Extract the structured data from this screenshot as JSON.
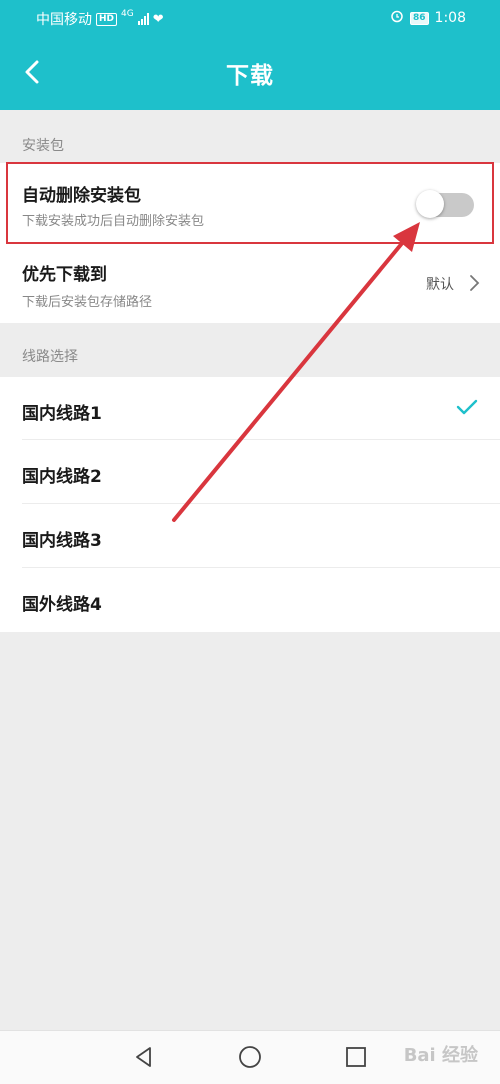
{
  "status_bar": {
    "carrier": "中国移动",
    "hd_badge": "HD",
    "network": "4G",
    "battery": "86",
    "time": "1:08"
  },
  "header": {
    "title": "下载",
    "back_icon": "chevron-left-icon"
  },
  "section_install": {
    "label": "安装包",
    "auto_delete": {
      "title": "自动删除安装包",
      "subtitle": "下载安装成功后自动删除安装包",
      "enabled": false
    },
    "preferred_location": {
      "title": "优先下载到",
      "subtitle": "下载后安装包存储路径",
      "value": "默认"
    }
  },
  "section_route": {
    "label": "线路选择",
    "options": [
      {
        "label": "国内线路1",
        "selected": true
      },
      {
        "label": "国内线路2",
        "selected": false
      },
      {
        "label": "国内线路3",
        "selected": false
      },
      {
        "label": "国外线路4",
        "selected": false
      }
    ]
  },
  "watermark": "Bai 经验",
  "colors": {
    "accent": "#1ec0cb",
    "annotation": "#d9363e",
    "background": "#ededed"
  }
}
